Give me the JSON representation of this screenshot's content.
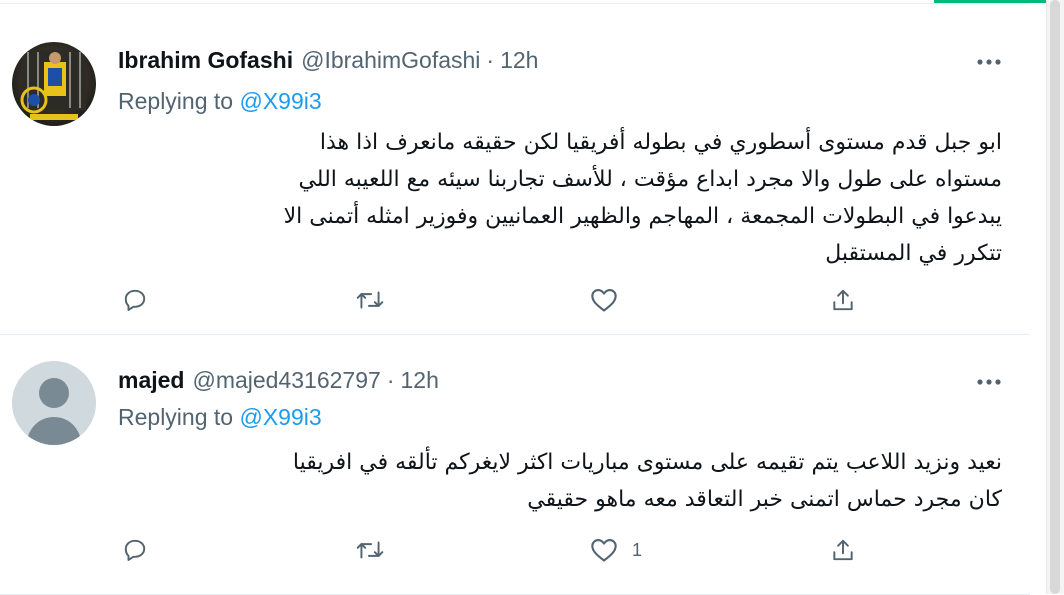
{
  "tweets": [
    {
      "name": "Ibrahim Gofashi",
      "handle": "@IbrahimGofashi",
      "separator": "·",
      "time": "12h",
      "replying_to_label": "Replying to",
      "mention": "@X99i3",
      "lines": [
        "ابو جبل قدم  مستوى أسطوري في بطوله أفريقيا  لكن حقيقه مانعرف اذا هذا",
        "مستواه على طول والا مجرد  ابداع مؤقت ،  للأسف تجاربنا سيئه مع اللعيبه اللي",
        "يبدعوا  في البطولات المجمعة  ، المهاجم والظهير العمانيين وفوزير امثله أتمنى الا",
        "تتكرر في المستقبل"
      ],
      "like_count": ""
    },
    {
      "name": "majed",
      "handle": "@majed43162797",
      "separator": "·",
      "time": "12h",
      "replying_to_label": "Replying to",
      "mention": "@X99i3",
      "lines": [
        "نعيد ونزيد اللاعب يتم تقيمه على مستوى مباريات اكثر لايغركم تألقه في افريقيا",
        "كان مجرد حماس اتمنى خبر التعاقد معه ماهو حقيقي"
      ],
      "like_count": "1"
    }
  ],
  "icons": {
    "more": "more-horizontal-icon",
    "reply": "reply-bubble-icon",
    "retweet": "retweet-icon",
    "like": "heart-icon",
    "share": "share-icon"
  },
  "colors": {
    "accent": "#1d9bf0",
    "muted": "#536471",
    "text": "#0f1419",
    "green_bar": "#00ba7c"
  }
}
